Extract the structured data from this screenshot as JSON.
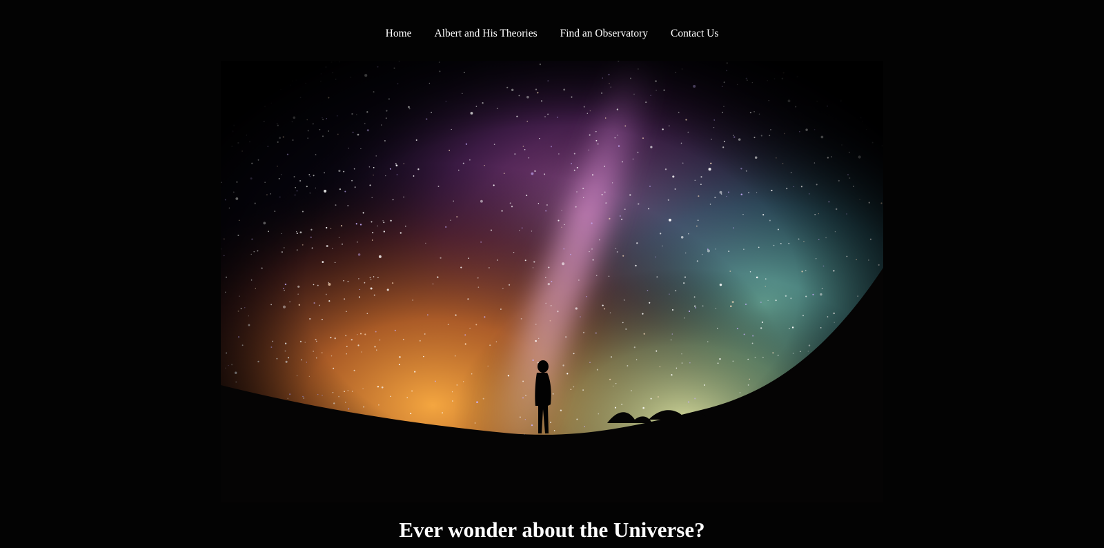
{
  "nav": {
    "items": [
      {
        "label": "Home"
      },
      {
        "label": "Albert and His Theories"
      },
      {
        "label": "Find an Observatory"
      },
      {
        "label": "Contact Us"
      }
    ]
  },
  "hero": {
    "icon": "night-sky-person-silhouette"
  },
  "headline": "Ever wonder about the Universe?"
}
